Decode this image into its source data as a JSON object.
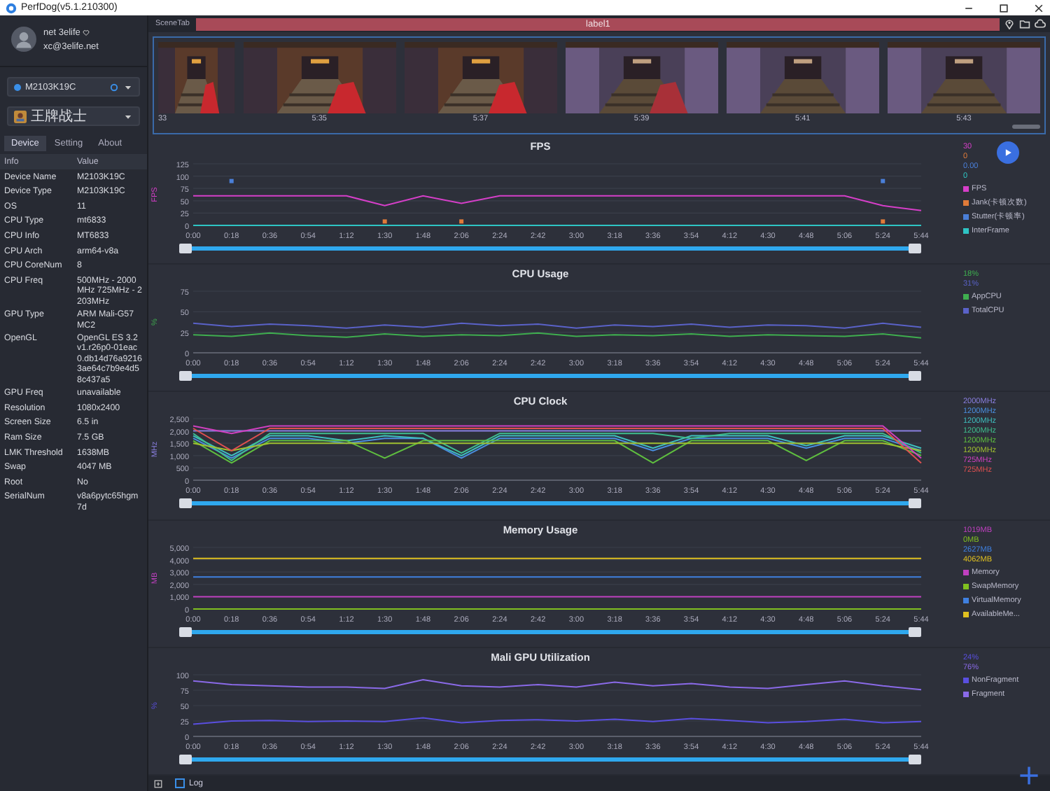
{
  "window": {
    "title": "PerfDog(v5.1.210300)"
  },
  "user": {
    "name": "net 3elife",
    "email": "xc@3elife.net"
  },
  "device_select": {
    "value": "M2103K19C"
  },
  "app_select": {
    "value": "王牌战士"
  },
  "tabs": [
    {
      "label": "Device",
      "selected": true
    },
    {
      "label": "Setting",
      "selected": false
    },
    {
      "label": "About",
      "selected": false
    }
  ],
  "info_table": {
    "columns": [
      "Info",
      "Value"
    ],
    "rows": [
      [
        "Device Name",
        "M2103K19C"
      ],
      [
        "Device Type",
        "M2103K19C"
      ],
      [
        "OS",
        "11"
      ],
      [
        "CPU Type",
        "mt6833"
      ],
      [
        "CPU Info",
        "MT6833"
      ],
      [
        "CPU Arch",
        "arm64-v8a"
      ],
      [
        "CPU CoreNum",
        "8"
      ],
      [
        "CPU Freq",
        "500MHz - 2000MHz 725MHz - 2203MHz"
      ],
      [
        "GPU Type",
        "ARM Mali-G57 MC2"
      ],
      [
        "OpenGL",
        "OpenGL ES 3.2 v1.r26p0-01eac0.db14d76a92163ae64c7b9e4d58c437a5"
      ],
      [
        "GPU Freq",
        "unavailable"
      ],
      [
        "Resolution",
        "1080x2400"
      ],
      [
        "Screen Size",
        "6.5 in"
      ],
      [
        "Ram Size",
        "7.5 GB"
      ],
      [
        "LMK Threshold",
        "1638MB"
      ],
      [
        "Swap",
        "4047 MB"
      ],
      [
        "Root",
        "No"
      ],
      [
        "SerialNum",
        "v8a6pytc65hgm7d"
      ]
    ]
  },
  "scene_bar": {
    "tab": "SceneTab",
    "label": "label1"
  },
  "thumbnails": [
    {
      "time": "33"
    },
    {
      "time": "5:35"
    },
    {
      "time": "5:37"
    },
    {
      "time": "5:39"
    },
    {
      "time": "5:41"
    },
    {
      "time": "5:43"
    }
  ],
  "charts": [
    {
      "readings": [
        "30",
        "0",
        "0.00",
        "0"
      ],
      "slider": {
        "level": 1
      },
      "chart_data": {
        "type": "line",
        "title": "FPS",
        "ylabel": "FPS",
        "grid": true,
        "categories": [
          "0:00",
          "0:18",
          "0:36",
          "0:54",
          "1:12",
          "1:30",
          "1:48",
          "2:06",
          "2:24",
          "2:42",
          "3:00",
          "3:18",
          "3:36",
          "3:54",
          "4:12",
          "4:30",
          "4:48",
          "5:06",
          "5:24",
          "5:44"
        ],
        "ylim": [
          0,
          125
        ],
        "yticks": [
          0,
          25,
          50,
          75,
          100,
          125
        ],
        "series": [
          {
            "name": "FPS",
            "color": "#d63fc9",
            "values": [
              60,
              60,
              60,
              60,
              60,
              40,
              60,
              45,
              60,
              60,
              60,
              60,
              60,
              60,
              60,
              60,
              60,
              60,
              40,
              30
            ]
          },
          {
            "name": "Jank(卡顿次数)",
            "type": "scatter",
            "color": "#e07b39",
            "values": [
              null,
              null,
              null,
              null,
              null,
              8,
              null,
              8,
              null,
              null,
              null,
              null,
              null,
              null,
              null,
              null,
              null,
              null,
              8,
              null
            ]
          },
          {
            "name": "Stutter(卡顿率)",
            "type": "scatter",
            "color": "#4a7fd8",
            "values": [
              null,
              90,
              null,
              null,
              null,
              null,
              null,
              null,
              null,
              null,
              null,
              null,
              null,
              null,
              null,
              null,
              null,
              null,
              90,
              null
            ]
          },
          {
            "name": "InterFrame",
            "color": "#2ec4c4",
            "values": [
              0,
              0,
              0,
              0,
              0,
              0,
              0,
              0,
              0,
              0,
              0,
              0,
              0,
              0,
              0,
              0,
              0,
              0,
              0,
              0
            ]
          }
        ]
      }
    },
    {
      "readings": [
        "18%",
        "31%"
      ],
      "slider": {
        "level": 1
      },
      "chart_data": {
        "type": "line",
        "title": "CPU Usage",
        "ylabel": "%",
        "grid": true,
        "categories": [
          "0:00",
          "0:18",
          "0:36",
          "0:54",
          "1:12",
          "1:30",
          "1:48",
          "2:06",
          "2:24",
          "2:42",
          "3:00",
          "3:18",
          "3:36",
          "3:54",
          "4:12",
          "4:30",
          "4:48",
          "5:06",
          "5:24",
          "5:44"
        ],
        "ylim": [
          0,
          75
        ],
        "yticks": [
          0,
          25,
          50,
          75
        ],
        "series": [
          {
            "name": "AppCPU",
            "color": "#3fae4f",
            "values": [
              22,
              20,
              24,
              21,
              19,
              23,
              20,
              22,
              21,
              24,
              20,
              22,
              21,
              23,
              20,
              22,
              21,
              20,
              23,
              18
            ]
          },
          {
            "name": "TotalCPU",
            "color": "#5a62c8",
            "values": [
              36,
              32,
              35,
              33,
              30,
              34,
              31,
              36,
              33,
              35,
              30,
              34,
              32,
              35,
              31,
              34,
              33,
              30,
              36,
              31
            ]
          }
        ]
      }
    },
    {
      "readings": [
        "2000MHz",
        "1200MHz",
        "1200MHz",
        "1200MHz",
        "1200MHz",
        "1200MHz",
        "725MHz",
        "725MHz"
      ],
      "slider": {
        "level": 1
      },
      "chart_data": {
        "type": "line",
        "title": "CPU Clock",
        "ylabel": "MHz",
        "grid": true,
        "categories": [
          "0:00",
          "0:18",
          "0:36",
          "0:54",
          "1:12",
          "1:30",
          "1:48",
          "2:06",
          "2:24",
          "2:42",
          "3:00",
          "3:18",
          "3:36",
          "3:54",
          "4:12",
          "4:30",
          "4:48",
          "5:06",
          "5:24",
          "5:44"
        ],
        "ylim": [
          0,
          2500
        ],
        "yticks": [
          {
            "value": 0,
            "label": "0"
          },
          {
            "value": 500,
            "label": "500"
          },
          {
            "value": 1000,
            "label": "1,000"
          },
          {
            "value": 1500,
            "label": "1,500"
          },
          {
            "value": 2000,
            "label": "2,000"
          },
          {
            "value": 2500,
            "label": "2,500"
          }
        ],
        "series": [
          {
            "color": "#8a7fe0",
            "values": [
              2000,
              2000,
              2000,
              2000,
              2000,
              2000,
              2000,
              2000,
              2000,
              2000,
              2000,
              2000,
              2000,
              2000,
              2000,
              2000,
              2000,
              2000,
              2000,
              2000
            ]
          },
          {
            "color": "#4a8fe0",
            "values": [
              1700,
              900,
              1700,
              1700,
              1500,
              1700,
              1700,
              900,
              1700,
              1700,
              1700,
              1700,
              1200,
              1700,
              1700,
              1700,
              1300,
              1700,
              1700,
              1200
            ]
          },
          {
            "color": "#3fbfbf",
            "values": [
              1800,
              1000,
              1800,
              1800,
              1600,
              1800,
              1700,
              1000,
              1800,
              1800,
              1800,
              1800,
              1300,
              1800,
              1800,
              1800,
              1400,
              1800,
              1800,
              1300
            ]
          },
          {
            "color": "#3fbf8f",
            "values": [
              1900,
              800,
              1900,
              1900,
              1900,
              1900,
              1900,
              1100,
              1900,
              1900,
              1900,
              1900,
              1900,
              1700,
              1900,
              1900,
              1900,
              1900,
              1900,
              1100
            ]
          },
          {
            "color": "#5fbf3f",
            "values": [
              1600,
              700,
              1600,
              1600,
              1600,
              900,
              1600,
              1600,
              1600,
              1600,
              1600,
              1600,
              700,
              1600,
              1600,
              1600,
              800,
              1600,
              1600,
              1000
            ]
          },
          {
            "color": "#a0c030",
            "values": [
              1500,
              1200,
              1500,
              1500,
              1500,
              1500,
              1500,
              1500,
              1500,
              1500,
              1500,
              1500,
              1500,
              1500,
              1500,
              1500,
              1500,
              1500,
              1500,
              1200
            ]
          },
          {
            "color": "#d040c0",
            "values": [
              2200,
              1900,
              2200,
              2200,
              2200,
              2200,
              2200,
              2200,
              2200,
              2200,
              2200,
              2200,
              2200,
              2200,
              2200,
              2200,
              2200,
              2200,
              2200,
              900
            ]
          },
          {
            "color": "#e05050",
            "values": [
              2100,
              1200,
              2100,
              2100,
              2100,
              2100,
              2100,
              2100,
              2100,
              2100,
              2100,
              2100,
              2100,
              2100,
              2100,
              2100,
              2100,
              2100,
              2100,
              700
            ]
          }
        ]
      }
    },
    {
      "readings": [
        "1019MB",
        "0MB",
        "2627MB",
        "4062MB"
      ],
      "slider": {
        "level": 1
      },
      "chart_data": {
        "type": "line",
        "title": "Memory Usage",
        "ylabel": "MB",
        "grid": true,
        "categories": [
          "0:00",
          "0:18",
          "0:36",
          "0:54",
          "1:12",
          "1:30",
          "1:48",
          "2:06",
          "2:24",
          "2:42",
          "3:00",
          "3:18",
          "3:36",
          "3:54",
          "4:12",
          "4:30",
          "4:48",
          "5:06",
          "5:24",
          "5:44"
        ],
        "ylim": [
          0,
          5000
        ],
        "yticks": [
          {
            "value": 0,
            "label": "0"
          },
          {
            "value": 1000,
            "label": "1,000"
          },
          {
            "value": 2000,
            "label": "2,000"
          },
          {
            "value": 3000,
            "label": "3,000"
          },
          {
            "value": 4000,
            "label": "4,000"
          },
          {
            "value": 5000,
            "label": "5,000"
          }
        ],
        "series": [
          {
            "name": "Memory",
            "color": "#c040c0",
            "values": [
              1000,
              1000,
              1000,
              1000,
              1000,
              1000,
              1000,
              1000,
              1000,
              1000,
              1000,
              1000,
              1000,
              1000,
              1000,
              1000,
              1000,
              1000,
              1000,
              1000
            ]
          },
          {
            "name": "SwapMemory",
            "color": "#80c020",
            "values": [
              0,
              0,
              0,
              0,
              0,
              0,
              0,
              0,
              0,
              0,
              0,
              0,
              0,
              0,
              0,
              0,
              0,
              0,
              0,
              0
            ]
          },
          {
            "name": "VirtualMemory",
            "color": "#3f80e0",
            "values": [
              2600,
              2600,
              2600,
              2600,
              2600,
              2600,
              2600,
              2600,
              2600,
              2600,
              2600,
              2600,
              2600,
              2600,
              2600,
              2600,
              2600,
              2600,
              2600,
              2600
            ]
          },
          {
            "name": "AvailableMe...",
            "color": "#e0c020",
            "values": [
              4100,
              4100,
              4100,
              4100,
              4100,
              4100,
              4100,
              4100,
              4100,
              4100,
              4100,
              4100,
              4100,
              4100,
              4100,
              4100,
              4100,
              4100,
              4100,
              4100
            ]
          }
        ]
      }
    },
    {
      "readings": [
        "24%",
        "76%"
      ],
      "slider": {
        "level": 1
      },
      "chart_data": {
        "type": "line",
        "title": "Mali GPU Utilization",
        "ylabel": "%",
        "grid": true,
        "categories": [
          "0:00",
          "0:18",
          "0:36",
          "0:54",
          "1:12",
          "1:30",
          "1:48",
          "2:06",
          "2:24",
          "2:42",
          "3:00",
          "3:18",
          "3:36",
          "3:54",
          "4:12",
          "4:30",
          "4:48",
          "5:06",
          "5:24",
          "5:44"
        ],
        "ylim": [
          0,
          100
        ],
        "yticks": [
          0,
          25,
          50,
          75,
          100
        ],
        "series": [
          {
            "name": "NonFragment",
            "color": "#5a4fe0",
            "values": [
              20,
              25,
              26,
              24,
              25,
              24,
              30,
              22,
              26,
              27,
              25,
              28,
              24,
              29,
              26,
              22,
              24,
              28,
              22,
              24
            ]
          },
          {
            "name": "Fragment",
            "color": "#8a6ae8",
            "values": [
              90,
              84,
              82,
              80,
              80,
              78,
              92,
              82,
              80,
              84,
              80,
              88,
              82,
              86,
              80,
              78,
              84,
              90,
              82,
              76
            ]
          }
        ]
      }
    }
  ],
  "bottom_bar": {
    "log": {
      "label": "Log",
      "checked": false
    }
  }
}
